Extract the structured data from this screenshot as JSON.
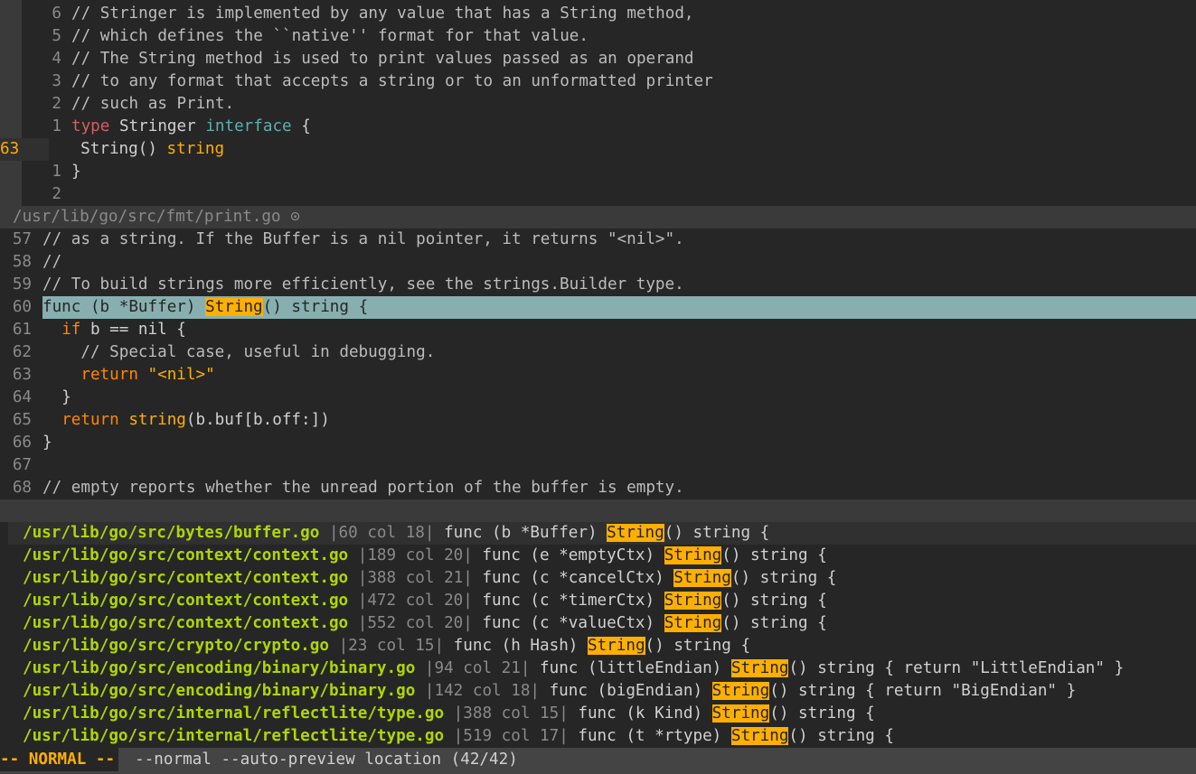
{
  "top_pane": {
    "lines": [
      {
        "num": "6",
        "text": "// Stringer is implemented by any value that has a String method,"
      },
      {
        "num": "5",
        "text": "// which defines the ``native'' format for that value."
      },
      {
        "num": "4",
        "text": "// The String method is used to print values passed as an operand"
      },
      {
        "num": "3",
        "text": "// to any format that accepts a string or to an unformatted printer"
      },
      {
        "num": "2",
        "text": "// such as Print."
      }
    ],
    "type_line": {
      "num": "1",
      "kw": "type",
      "name": " Stringer ",
      "iface": "interface",
      "rest": " {"
    },
    "current_line": {
      "num": "63",
      "text": "  String() ",
      "type": "string"
    },
    "close_line": {
      "num": "1",
      "text": "}"
    },
    "empty_line": {
      "num": "2",
      "text": ""
    }
  },
  "preview_status": {
    "path": "/usr/lib/go/src/fmt/print.go",
    "icon": "⊙"
  },
  "preview_pane": {
    "lines": [
      {
        "num": "57",
        "text": "// as a string. If the Buffer is a nil pointer, it returns \"<nil>\"."
      },
      {
        "num": "58",
        "text": "//"
      },
      {
        "num": "59",
        "text": "// To build strings more efficiently, see the strings.Builder type."
      }
    ],
    "highlight": {
      "num": "60",
      "pre": "func (b *Buffer) ",
      "match": "String",
      "post": "() string {"
    },
    "body": [
      {
        "num": "61",
        "indent": "  ",
        "kw": "if",
        "rest": " b == nil {"
      },
      {
        "num": "62",
        "text": "    // Special case, useful in debugging."
      },
      {
        "num": "63",
        "indent": "    ",
        "kw": "return",
        "str": " \"<nil>\""
      },
      {
        "num": "64",
        "text": "  }"
      },
      {
        "num": "65",
        "indent": "  ",
        "kw": "return",
        "call": " string",
        "rest": "(b.buf[b.off:])"
      },
      {
        "num": "66",
        "text": "}"
      },
      {
        "num": "67",
        "text": ""
      },
      {
        "num": "68",
        "text": "// empty reports whether the unread portion of the buffer is empty."
      }
    ]
  },
  "location_list": [
    {
      "path": "/usr/lib/go/src/bytes/buffer.go",
      "pos": "|60 col 18|",
      "pre": " func (b *Buffer) ",
      "match": "String",
      "post": "() string {"
    },
    {
      "path": "/usr/lib/go/src/context/context.go",
      "pos": "|189 col 20|",
      "pre": " func (e *emptyCtx) ",
      "match": "String",
      "post": "() string {"
    },
    {
      "path": "/usr/lib/go/src/context/context.go",
      "pos": "|388 col 21|",
      "pre": " func (c *cancelCtx) ",
      "match": "String",
      "post": "() string {"
    },
    {
      "path": "/usr/lib/go/src/context/context.go",
      "pos": "|472 col 20|",
      "pre": " func (c *timerCtx) ",
      "match": "String",
      "post": "() string {"
    },
    {
      "path": "/usr/lib/go/src/context/context.go",
      "pos": "|552 col 20|",
      "pre": " func (c *valueCtx) ",
      "match": "String",
      "post": "() string {"
    },
    {
      "path": "/usr/lib/go/src/crypto/crypto.go",
      "pos": "|23 col 15|",
      "pre": " func (h Hash) ",
      "match": "String",
      "post": "() string {"
    },
    {
      "path": "/usr/lib/go/src/encoding/binary/binary.go",
      "pos": "|94 col 21|",
      "pre": " func (littleEndian) ",
      "match": "String",
      "post": "() string { return \"LittleEndian\" }"
    },
    {
      "path": "/usr/lib/go/src/encoding/binary/binary.go",
      "pos": "|142 col 18|",
      "pre": " func (bigEndian) ",
      "match": "String",
      "post": "() string { return \"BigEndian\" }"
    },
    {
      "path": "/usr/lib/go/src/internal/reflectlite/type.go",
      "pos": "|388 col 15|",
      "pre": " func (k Kind) ",
      "match": "String",
      "post": "() string {"
    },
    {
      "path": "/usr/lib/go/src/internal/reflectlite/type.go",
      "pos": "|519 col 17|",
      "pre": " func (t *rtype) ",
      "match": "String",
      "post": "() string {"
    }
  ],
  "status": {
    "mode": "-- NORMAL --",
    "prompt": "--normal --auto-preview location (42/42)"
  }
}
